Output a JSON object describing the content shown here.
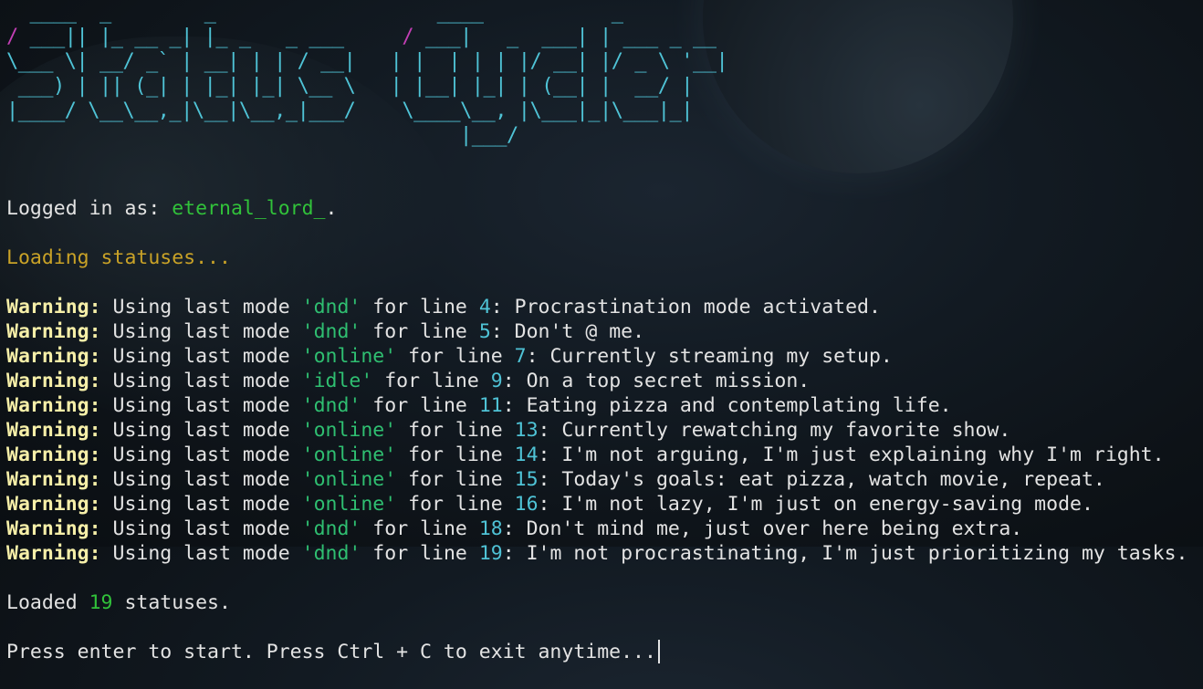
{
  "banner": {
    "title": "Status Cycler"
  },
  "login": {
    "prefix": "Logged in as: ",
    "username": "eternal_lord_",
    "suffix": "."
  },
  "loading_text": "Loading statuses...",
  "warning_parts": {
    "label": "Warning:",
    "prefix": " Using last mode ",
    "middle": " for line ",
    "colon": ": "
  },
  "warnings": [
    {
      "mode": "'dnd'",
      "line": "4",
      "message": "Procrastination mode activated."
    },
    {
      "mode": "'dnd'",
      "line": "5",
      "message": "Don't @ me."
    },
    {
      "mode": "'online'",
      "line": "7",
      "message": "Currently streaming my setup."
    },
    {
      "mode": "'idle'",
      "line": "9",
      "message": "On a top secret mission."
    },
    {
      "mode": "'dnd'",
      "line": "11",
      "message": "Eating pizza and contemplating life."
    },
    {
      "mode": "'online'",
      "line": "13",
      "message": "Currently rewatching my favorite show."
    },
    {
      "mode": "'online'",
      "line": "14",
      "message": "I'm not arguing, I'm just explaining why I'm right."
    },
    {
      "mode": "'online'",
      "line": "15",
      "message": "Today's goals: eat pizza, watch movie, repeat."
    },
    {
      "mode": "'online'",
      "line": "16",
      "message": "I'm not lazy, I'm just on energy-saving mode."
    },
    {
      "mode": "'dnd'",
      "line": "18",
      "message": "Don't mind me, just over here being extra."
    },
    {
      "mode": "'dnd'",
      "line": "19",
      "message": "I'm not procrastinating, I'm just prioritizing my tasks."
    }
  ],
  "loaded": {
    "prefix": "Loaded ",
    "count": "19",
    "suffix": " statuses."
  },
  "prompt_text": "Press enter to start. Press Ctrl + C to exit anytime...",
  "colors": {
    "banner": "#4fc3d6",
    "banner_accent": "#c33fb5",
    "username": "#31c23a",
    "loading": "#c9a227",
    "warning_label": "#f6efa8",
    "mode": "#2fbf71",
    "line_number": "#4fc3d6",
    "text": "#e3e3e3"
  }
}
